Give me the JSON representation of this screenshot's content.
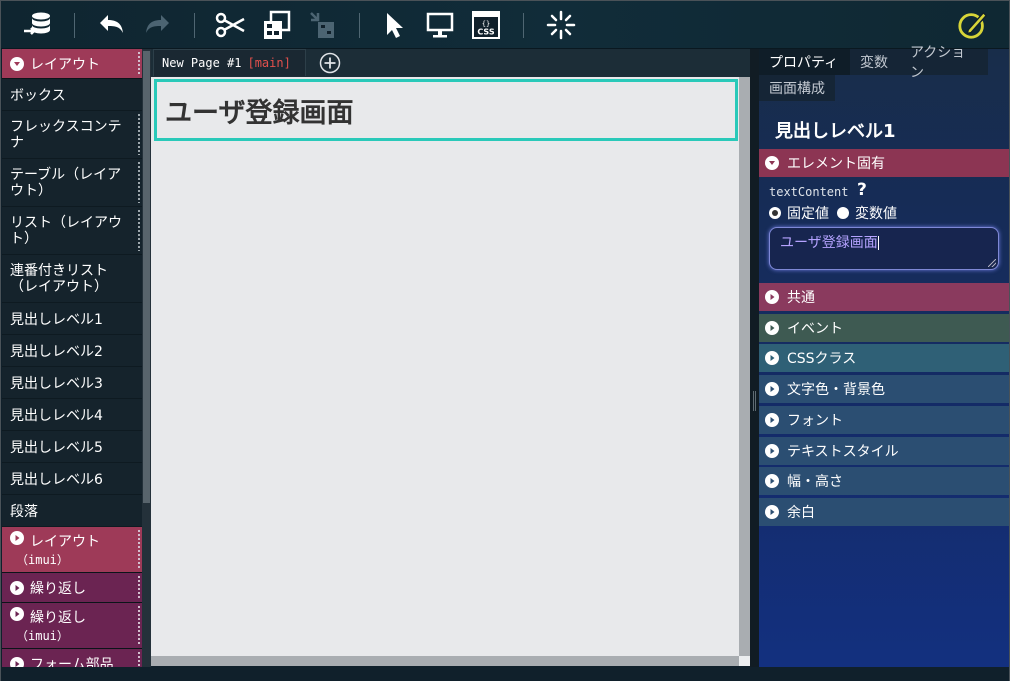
{
  "toolbar": {
    "icons": [
      "database-sync-icon",
      "undo-icon",
      "redo-icon",
      "cut-icon",
      "tree-copy-icon",
      "tree-paste-icon",
      "pointer-icon",
      "monitor-icon",
      "css-icon",
      "loading-icon",
      "edit-icon"
    ],
    "css_label": "CSS",
    "css_braces": "{}"
  },
  "palette": {
    "layout_category": "レイアウト",
    "items": [
      "ボックス",
      "フレックスコンテナ",
      "テーブル（レイアウト）",
      "リスト（レイアウト）",
      "連番付きリスト（レイアウト）",
      "見出しレベル1",
      "見出しレベル2",
      "見出しレベル3",
      "見出しレベル4",
      "見出しレベル5",
      "見出しレベル6",
      "段落"
    ],
    "item_lines": [
      [
        "ボックス"
      ],
      [
        "フレックスコンテ",
        "ナ"
      ],
      [
        "テーブル（レイア",
        "ウト）"
      ],
      [
        "リスト（レイアウ",
        "ト）"
      ],
      [
        "連番付きリスト",
        "（レイアウト）"
      ],
      [
        "見出しレベル1"
      ],
      [
        "見出しレベル2"
      ],
      [
        "見出しレベル3"
      ],
      [
        "見出しレベル4"
      ],
      [
        "見出しレベル5"
      ],
      [
        "見出しレベル6"
      ],
      [
        "段落"
      ]
    ],
    "categories": [
      {
        "label": "レイアウト",
        "sub": "（imui）",
        "color": "#9e3a58"
      },
      {
        "label": "繰り返し",
        "sub": "",
        "color": "#6b2452"
      },
      {
        "label": "繰り返し",
        "sub": "（imui）",
        "color": "#6b2452"
      },
      {
        "label": "フォーム部品",
        "sub": "",
        "color": "#6b2452"
      }
    ]
  },
  "canvas": {
    "tab_label": "New Page #1",
    "tab_branch": "[main]",
    "heading_text": "ユーザ登録画面"
  },
  "props": {
    "tabs": [
      "プロパティ",
      "変数",
      "アクション",
      "画面構成"
    ],
    "title": "見出しレベル1",
    "element_section": "エレメント固有",
    "text_content_label": "textContent",
    "help": "?",
    "radio_fixed": "固定値",
    "radio_variable": "変数値",
    "input_value": "ユーザ登録画面",
    "sections": [
      {
        "label": "共通",
        "color": "#8a3a5e"
      },
      {
        "label": "イベント",
        "color": "#3e5a52"
      },
      {
        "label": "CSSクラス",
        "color": "#2f6076"
      },
      {
        "label": "文字色・背景色",
        "color": "#2b4e72"
      },
      {
        "label": "フォント",
        "color": "#2b4e72"
      },
      {
        "label": "テキストスタイル",
        "color": "#2b4e72"
      },
      {
        "label": "幅・高さ",
        "color": "#2b4e72"
      },
      {
        "label": "余白",
        "color": "#2b4e72"
      }
    ],
    "element_section_color": "#8c3553"
  }
}
